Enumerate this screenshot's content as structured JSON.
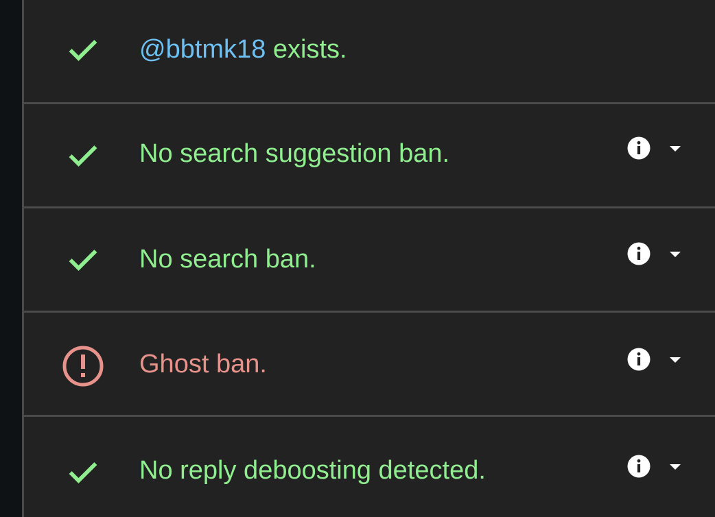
{
  "colors": {
    "ok": "#90ee90",
    "warn": "#e8928c",
    "handle": "#6ec0f2",
    "panel": "#222222"
  },
  "rows": [
    {
      "status": "check-icon",
      "handle": "@bbtmk18",
      "text": " exists."
    },
    {
      "status": "check-icon",
      "text": "No search suggestion ban.",
      "icons": [
        "info-icon",
        "caret-down-icon"
      ]
    },
    {
      "status": "check-icon",
      "text": "No search ban.",
      "icons": [
        "info-icon",
        "caret-down-icon"
      ]
    },
    {
      "status": "alert-circle-icon",
      "text": "Ghost ban.",
      "icons": [
        "info-icon",
        "caret-down-icon"
      ]
    },
    {
      "status": "check-icon",
      "text": "No reply deboosting detected.",
      "icons": [
        "info-icon",
        "caret-down-icon"
      ]
    }
  ]
}
